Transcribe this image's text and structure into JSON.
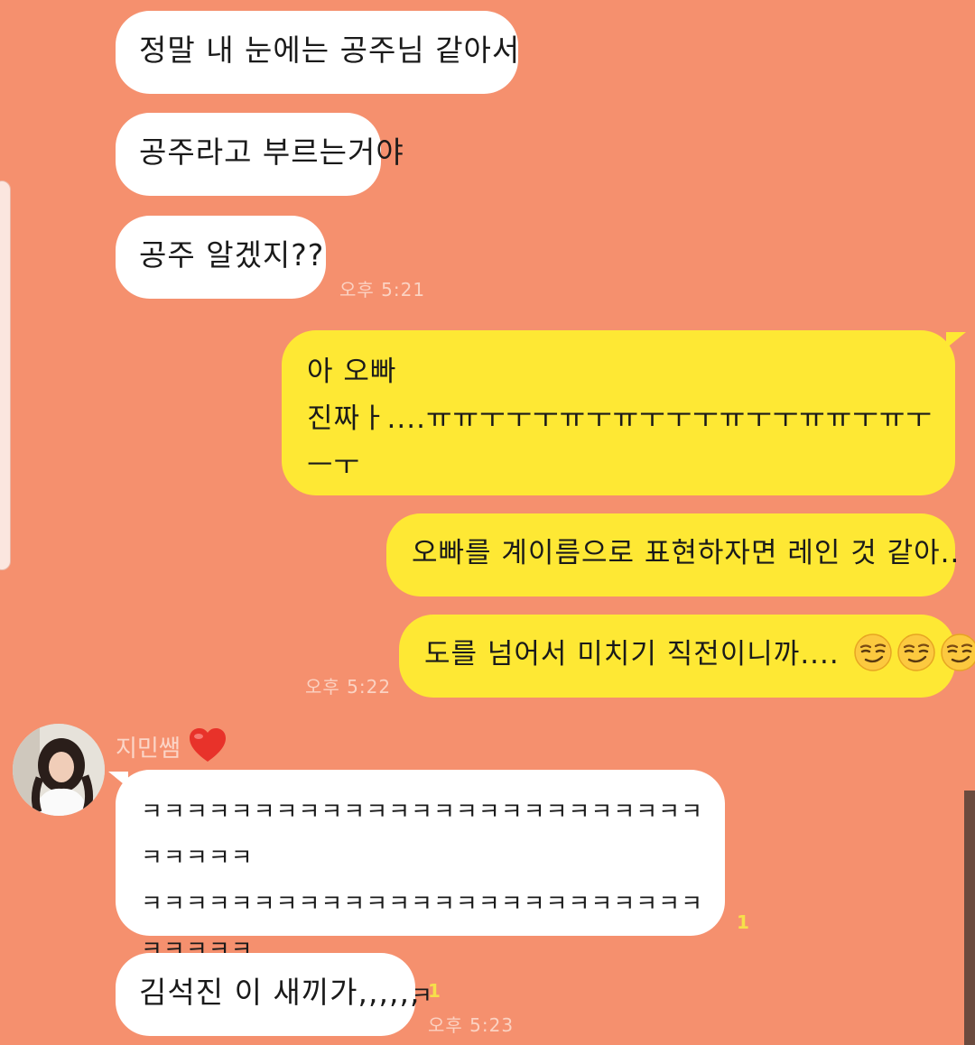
{
  "messages": [
    {
      "id": "m1",
      "side": "in",
      "text": "정말 내 눈에는 공주님 같아서"
    },
    {
      "id": "m2",
      "side": "in",
      "text": "공주라고 부르는거야"
    },
    {
      "id": "m3",
      "side": "in",
      "text": "공주 알겠지??",
      "time": "오후 5:21"
    },
    {
      "id": "m4",
      "side": "out",
      "lines": [
        "아 오빠",
        "진짜ㅏ....ㅠㅠㅜㅜㅜㅠㅜㅠㅜㅜㅜㅠㅜㅜㅠㅠㅜㅠㅜ",
        "ㅡㅜ"
      ]
    },
    {
      "id": "m5",
      "side": "out",
      "text": "오빠를 계이름으로 표현하자면 레인 것 같아.."
    },
    {
      "id": "m6",
      "side": "out",
      "text": "도를 넘어서 미치기 직전이니까....",
      "emoji": [
        "smirking-face",
        "smirking-face",
        "smirking-face"
      ],
      "time": "오후 5:22"
    },
    {
      "id": "m7",
      "side": "in",
      "sender": "지민쌤",
      "sender_emoji": "red-heart",
      "lines": [
        "ㅋㅋㅋㅋㅋㅋㅋㅋㅋㅋㅋㅋㅋㅋㅋㅋㅋㅋㅋㅋㅋㅋㅋㅋㅋㅋㅋㅋㅋㅋ",
        "ㅋㅋㅋㅋㅋㅋㅋㅋㅋㅋㅋㅋㅋㅋㅋㅋㅋㅋㅋㅋㅋㅋㅋㅋㅋㅋㅋㅋㅋㅋ",
        "ㅋㅋㅋㅋㅋㅋㅋㅋㅋㅋㅋㅋㅋ"
      ],
      "read": "1"
    },
    {
      "id": "m8",
      "side": "in",
      "text": "김석진 이 새끼가,,,,,,",
      "read": "1",
      "time": "오후 5:23"
    }
  ],
  "colors": {
    "background": "#f5906e",
    "incoming_bubble": "#ffffff",
    "outgoing_bubble": "#fee834",
    "timestamp": "#fbd2c2",
    "read_count": "#f6e04a"
  }
}
